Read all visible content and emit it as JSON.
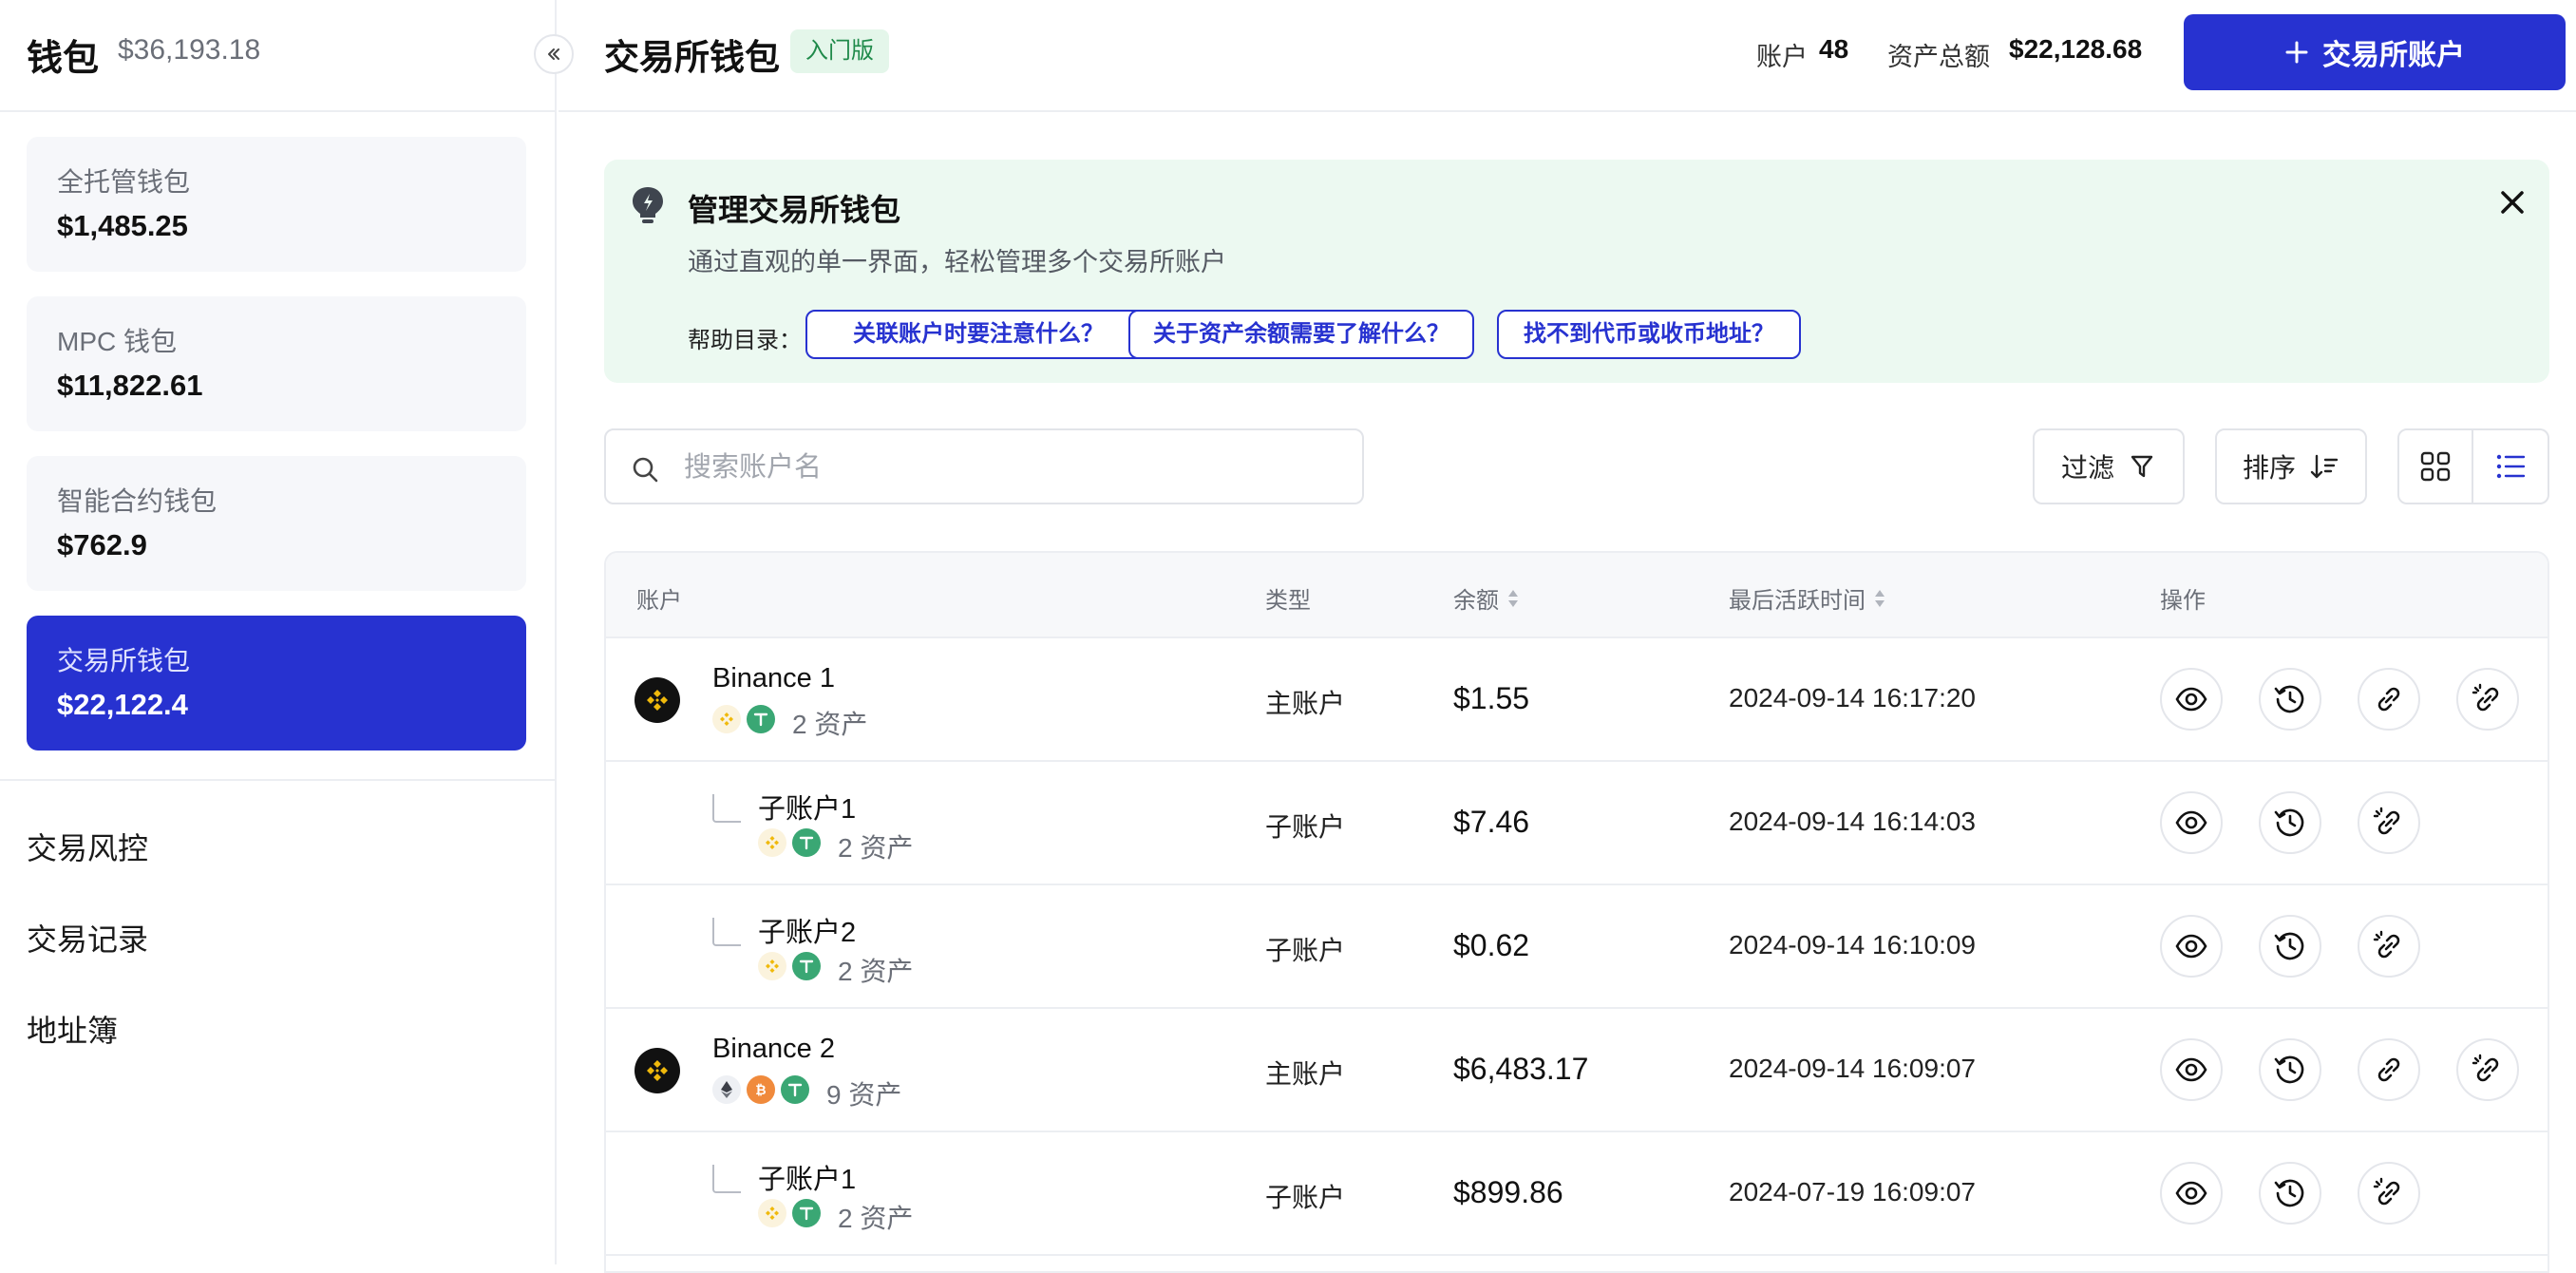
{
  "sidebar": {
    "title": "钱包",
    "total": "$36,193.18",
    "wallets": [
      {
        "label": "全托管钱包",
        "value": "$1,485.25"
      },
      {
        "label": "MPC 钱包",
        "value": "$11,822.61"
      },
      {
        "label": "智能合约钱包",
        "value": "$762.9"
      },
      {
        "label": "交易所钱包",
        "value": "$22,122.4",
        "active": true
      }
    ],
    "nav": [
      "交易风控",
      "交易记录",
      "地址簿"
    ]
  },
  "header": {
    "title": "交易所钱包",
    "badge": "入门版",
    "accounts_label": "账户",
    "accounts_value": "48",
    "assets_label": "资产总额",
    "assets_value": "$22,128.68",
    "add_button": "交易所账户"
  },
  "banner": {
    "title": "管理交易所钱包",
    "description": "通过直观的单一界面，轻松管理多个交易所账户",
    "help_label": "帮助目录：",
    "links": [
      "关联账户时要注意什么？",
      "关于资产余额需要了解什么？",
      "找不到代币或收币地址？"
    ]
  },
  "toolbar": {
    "search_placeholder": "搜索账户名",
    "filter_label": "过滤",
    "sort_label": "排序"
  },
  "table": {
    "columns": {
      "account": "账户",
      "type": "类型",
      "balance": "余额",
      "last_active": "最后活跃时间",
      "actions": "操作"
    },
    "rows": [
      {
        "name": "Binance 1",
        "assets": "2 资产",
        "type": "主账户",
        "balance": "$1.55",
        "time": "2024-09-14 16:17:20",
        "main": true,
        "coins": [
          "bnb",
          "usdt"
        ]
      },
      {
        "name": "子账户1",
        "assets": "2 资产",
        "type": "子账户",
        "balance": "$7.46",
        "time": "2024-09-14 16:14:03",
        "main": false,
        "coins": [
          "bnb",
          "usdt"
        ]
      },
      {
        "name": "子账户2",
        "assets": "2 资产",
        "type": "子账户",
        "balance": "$0.62",
        "time": "2024-09-14 16:10:09",
        "main": false,
        "coins": [
          "bnb",
          "usdt"
        ]
      },
      {
        "name": "Binance 2",
        "assets": "9 资产",
        "type": "主账户",
        "balance": "$6,483.17",
        "time": "2024-09-14 16:09:07",
        "main": true,
        "coins": [
          "eth",
          "btc",
          "usdt"
        ]
      },
      {
        "name": "子账户1",
        "assets": "2 资产",
        "type": "子账户",
        "balance": "$899.86",
        "time": "2024-07-19 16:09:07",
        "main": false,
        "coins": [
          "bnb",
          "usdt"
        ]
      }
    ]
  },
  "colors": {
    "primary": "#2732d0",
    "banner_bg": "#ecf9f1",
    "badge_text": "#1f8a4a",
    "binance_yellow": "#f0b90b",
    "usdt_green": "#3aa774",
    "btc_orange": "#f08a3c"
  },
  "icons": [
    "collapse-icon",
    "plus-icon",
    "lightbulb-icon",
    "close-icon",
    "search-icon",
    "filter-icon",
    "sort-icon",
    "grid-view-icon",
    "list-view-icon",
    "binance-logo-icon",
    "bnb-coin-icon",
    "usdt-coin-icon",
    "eth-coin-icon",
    "btc-coin-icon",
    "sort-arrows-icon",
    "eye-icon",
    "history-icon",
    "link-icon",
    "unlink-icon"
  ]
}
